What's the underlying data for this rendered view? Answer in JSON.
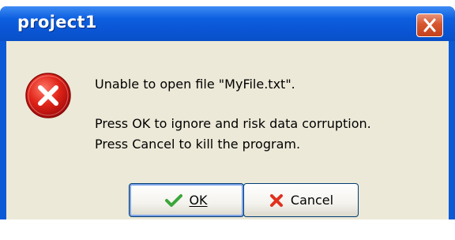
{
  "dialog": {
    "title": "project1",
    "close_icon": "close-icon",
    "icon": "error-icon",
    "message_line1": "Unable to open file \"MyFile.txt\".",
    "message_line2": "Press OK to ignore and risk data corruption.",
    "message_line3": "Press Cancel to kill the program."
  },
  "buttons": {
    "ok_label": "OK",
    "ok_icon": "checkmark-icon",
    "cancel_label": "Cancel",
    "cancel_icon": "cross-icon"
  },
  "colors": {
    "titlebar": "#0a5ad8",
    "client_bg": "#ece9d8",
    "error_red": "#d21818",
    "close_button": "#d6562e"
  }
}
